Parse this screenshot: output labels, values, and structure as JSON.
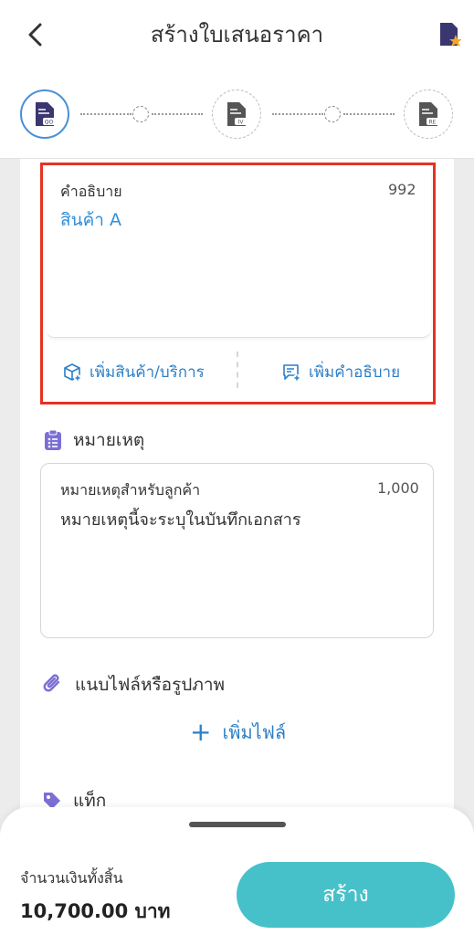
{
  "header": {
    "title": "สร้างใบเสนอราคา",
    "back_icon": "chevron-left-icon",
    "favorite_doc_icon": "document-star-icon"
  },
  "stepper": {
    "steps": [
      {
        "code": "QO",
        "icon": "document-qo-icon",
        "state": "active"
      },
      {
        "code": "IV",
        "icon": "document-iv-icon",
        "state": "pending"
      },
      {
        "code": "RE",
        "icon": "document-re-icon",
        "state": "pending"
      }
    ]
  },
  "description": {
    "label": "คำอธิบาย",
    "remaining_count": "992",
    "value": "สินค้า A",
    "add_product_label": "เพิ่มสินค้า/บริการ",
    "add_description_label": "เพิ่มคำอธิบาย"
  },
  "note": {
    "section_title": "หมายเหตุ",
    "field_label": "หมายเหตุสำหรับลูกค้า",
    "remaining_count": "1,000",
    "value": "หมายเหตุนี้จะระบุในบันทึกเอกสาร"
  },
  "attachment": {
    "section_title": "แนบไฟล์หรือรูปภาพ",
    "add_file_label": "เพิ่มไฟล์"
  },
  "tags": {
    "section_title": "แท็ก"
  },
  "footer": {
    "total_label": "จำนวนเงินทั้งสิ้น",
    "total_value": "10,700.00 บาท",
    "create_label": "สร้าง"
  },
  "colors": {
    "accent_blue": "#2c7fc7",
    "create_button": "#47c1c9",
    "highlight_border": "#e53222",
    "section_icon_purple": "#7b6fd6"
  }
}
